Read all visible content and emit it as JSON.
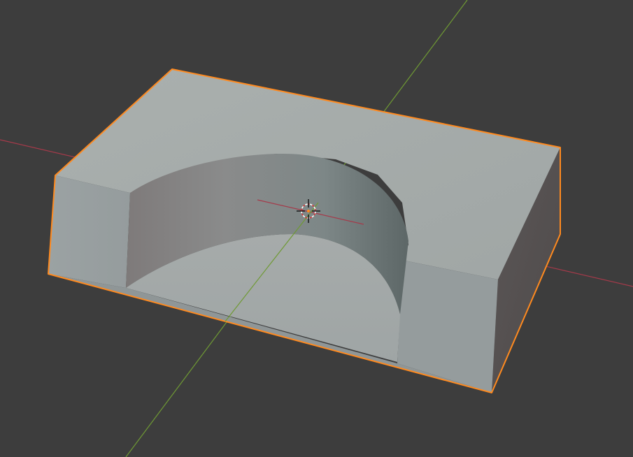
{
  "viewport": {
    "background_color": "#3d3d3d",
    "x_axis_color": "#a53a4a",
    "y_axis_color": "#6f9a34",
    "selection_outline_color": "#ff8a1f"
  },
  "object": {
    "selected": true,
    "shading": "solid",
    "description_icon": "mesh-object"
  },
  "cursor": {
    "icon": "3d-cursor-icon"
  }
}
